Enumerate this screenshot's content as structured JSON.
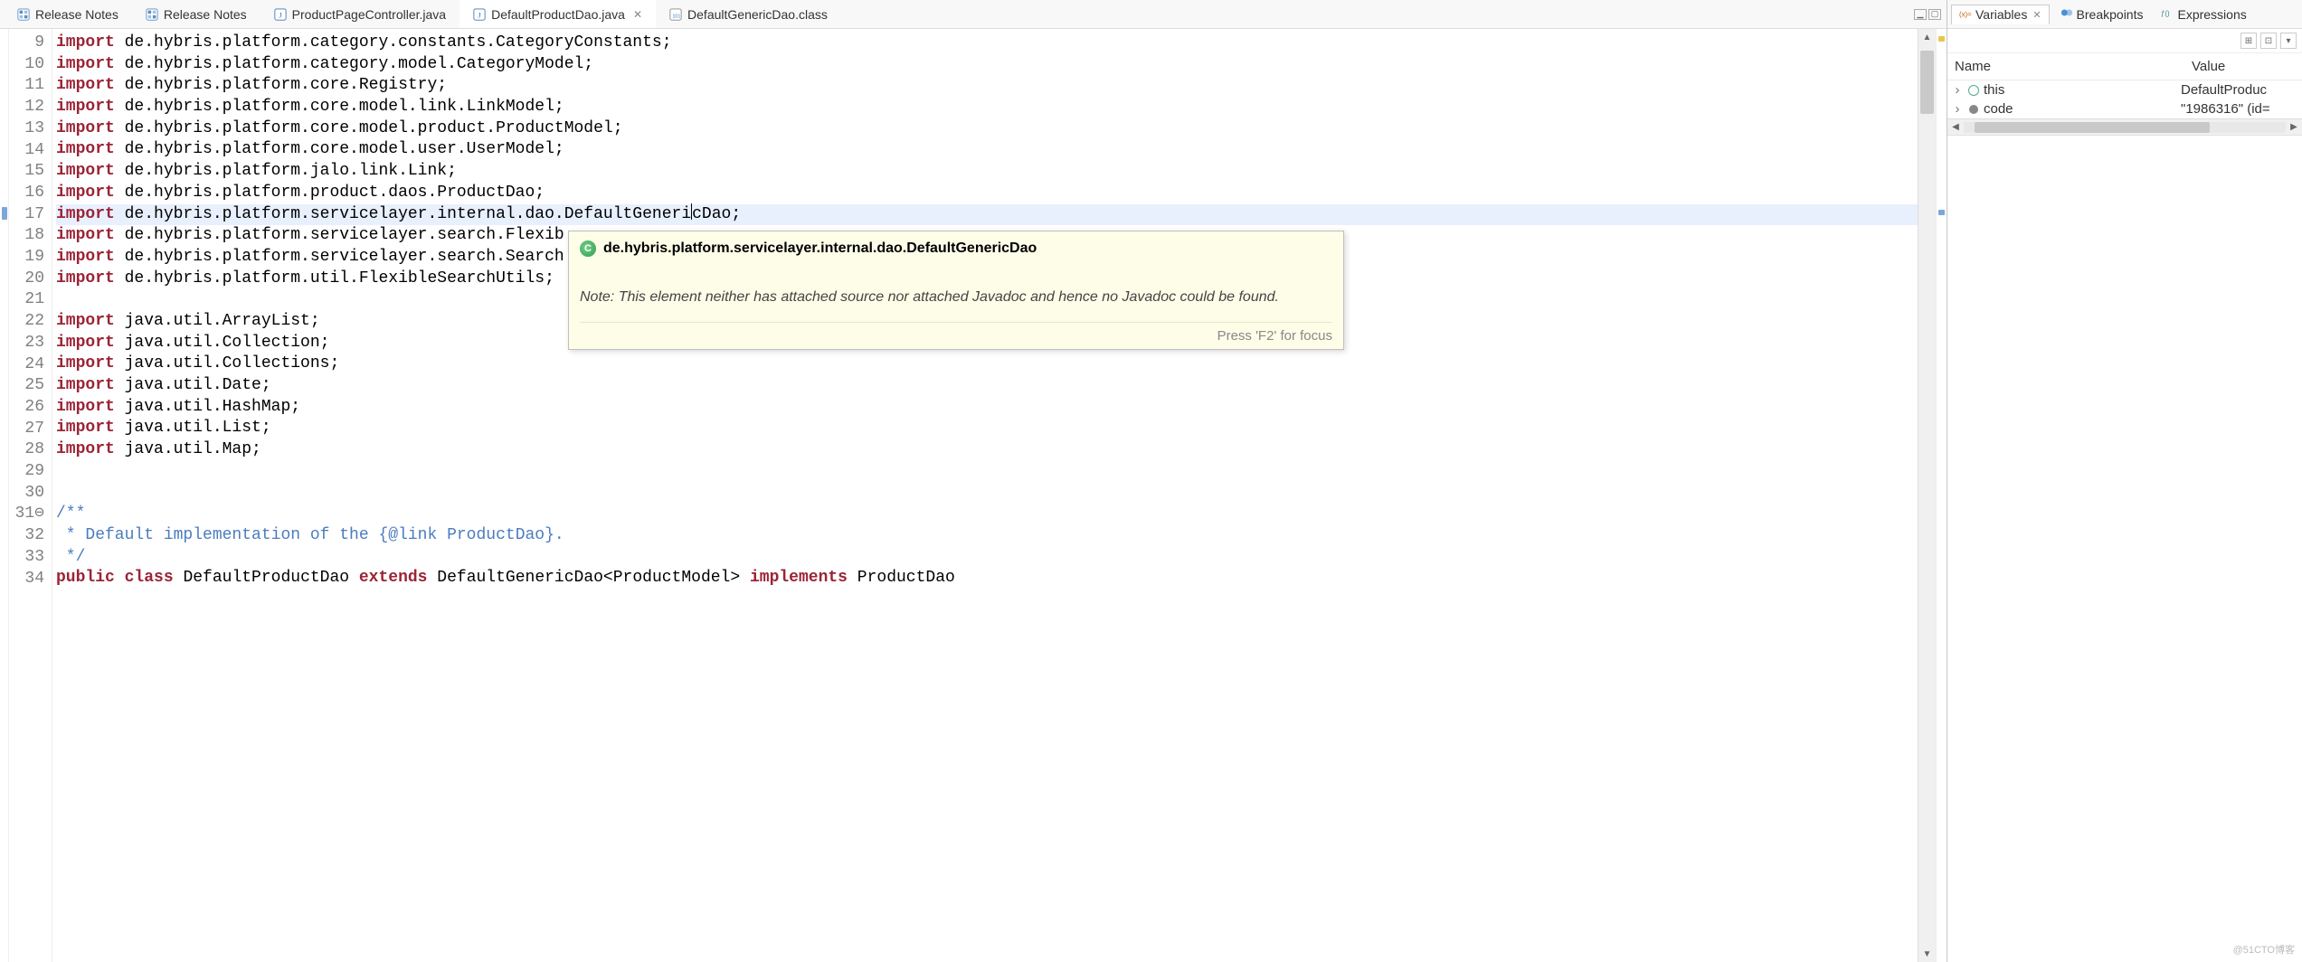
{
  "editor_tabs": [
    {
      "id": "release-notes-1",
      "label": "Release Notes",
      "icon": "feature",
      "active": false,
      "closable": false
    },
    {
      "id": "release-notes-2",
      "label": "Release Notes",
      "icon": "feature",
      "active": false,
      "closable": false
    },
    {
      "id": "product-page-controller",
      "label": "ProductPageController.java",
      "icon": "java",
      "active": false,
      "closable": false
    },
    {
      "id": "default-product-dao",
      "label": "DefaultProductDao.java",
      "icon": "java",
      "active": true,
      "closable": true
    },
    {
      "id": "default-generic-dao",
      "label": "DefaultGenericDao.class",
      "icon": "class",
      "active": false,
      "closable": false
    }
  ],
  "right_tabs": [
    {
      "id": "variables",
      "label": "Variables",
      "active": true,
      "closable": true
    },
    {
      "id": "breakpoints",
      "label": "Breakpoints",
      "active": false,
      "closable": false
    },
    {
      "id": "expressions",
      "label": "Expressions",
      "active": false,
      "closable": false
    }
  ],
  "variables_view": {
    "columns": {
      "name": "Name",
      "value": "Value"
    },
    "rows": [
      {
        "name": "this",
        "value": "DefaultProduc",
        "icon": "circle"
      },
      {
        "name": "code",
        "value": "\"1986316\" (id=",
        "icon": "dot"
      }
    ]
  },
  "line_start": 9,
  "highlighted_line": 17,
  "code_lines": [
    {
      "n": 9,
      "tokens": [
        [
          "import",
          "kw-import"
        ],
        [
          " de.hybris.platform.category.constants.CategoryConstants;",
          null
        ]
      ]
    },
    {
      "n": 10,
      "tokens": [
        [
          "import",
          "kw-import"
        ],
        [
          " de.hybris.platform.category.model.CategoryModel;",
          null
        ]
      ]
    },
    {
      "n": 11,
      "tokens": [
        [
          "import",
          "kw-import"
        ],
        [
          " de.hybris.platform.core.Registry;",
          null
        ]
      ]
    },
    {
      "n": 12,
      "tokens": [
        [
          "import",
          "kw-import"
        ],
        [
          " de.hybris.platform.core.model.link.LinkModel;",
          null
        ]
      ]
    },
    {
      "n": 13,
      "tokens": [
        [
          "import",
          "kw-import"
        ],
        [
          " de.hybris.platform.core.model.product.ProductModel;",
          null
        ]
      ]
    },
    {
      "n": 14,
      "tokens": [
        [
          "import",
          "kw-import"
        ],
        [
          " de.hybris.platform.core.model.user.UserModel;",
          null
        ]
      ]
    },
    {
      "n": 15,
      "tokens": [
        [
          "import",
          "kw-import"
        ],
        [
          " de.hybris.platform.jalo.link.Link;",
          null
        ]
      ]
    },
    {
      "n": 16,
      "tokens": [
        [
          "import",
          "kw-import"
        ],
        [
          " de.hybris.platform.product.daos.ProductDao;",
          null
        ]
      ]
    },
    {
      "n": 17,
      "highlight": true,
      "cursor_after": "DefaultGeneri",
      "tokens": [
        [
          "import",
          "kw-import"
        ],
        [
          " de.hybris.platform.servicelayer.internal.dao.DefaultGeneri",
          null
        ],
        [
          "|",
          "cursor"
        ],
        [
          "cDao;",
          null
        ]
      ]
    },
    {
      "n": 18,
      "tokens": [
        [
          "import",
          "kw-import"
        ],
        [
          " de.hybris.platform.servicelayer.search.Flexib",
          null
        ]
      ]
    },
    {
      "n": 19,
      "tokens": [
        [
          "import",
          "kw-import"
        ],
        [
          " de.hybris.platform.servicelayer.search.Search",
          null
        ]
      ]
    },
    {
      "n": 20,
      "tokens": [
        [
          "import",
          "kw-import"
        ],
        [
          " de.hybris.platform.util.FlexibleSearchUtils;",
          null
        ]
      ]
    },
    {
      "n": 21,
      "tokens": [
        [
          "",
          null
        ]
      ]
    },
    {
      "n": 22,
      "tokens": [
        [
          "import",
          "kw-import"
        ],
        [
          " java.util.ArrayList;",
          null
        ]
      ]
    },
    {
      "n": 23,
      "tokens": [
        [
          "import",
          "kw-import"
        ],
        [
          " java.util.Collection;",
          null
        ]
      ]
    },
    {
      "n": 24,
      "tokens": [
        [
          "import",
          "kw-import"
        ],
        [
          " java.util.Collections;",
          null
        ]
      ]
    },
    {
      "n": 25,
      "tokens": [
        [
          "import",
          "kw-import"
        ],
        [
          " java.util.Date;",
          null
        ]
      ]
    },
    {
      "n": 26,
      "tokens": [
        [
          "import",
          "kw-import"
        ],
        [
          " java.util.HashMap;",
          null
        ]
      ]
    },
    {
      "n": 27,
      "tokens": [
        [
          "import",
          "kw-import"
        ],
        [
          " java.util.List;",
          null
        ]
      ]
    },
    {
      "n": 28,
      "tokens": [
        [
          "import",
          "kw-import"
        ],
        [
          " java.util.Map;",
          null
        ]
      ]
    },
    {
      "n": 29,
      "tokens": [
        [
          "",
          null
        ]
      ]
    },
    {
      "n": 30,
      "tokens": [
        [
          "",
          null
        ]
      ]
    },
    {
      "n": 31,
      "fold": true,
      "tokens": [
        [
          "/**",
          "comment"
        ]
      ]
    },
    {
      "n": 32,
      "tokens": [
        [
          " * Default implementation of the {",
          "comment"
        ],
        [
          "@link",
          "comment"
        ],
        [
          " ProductDao}.",
          "comment"
        ]
      ]
    },
    {
      "n": 33,
      "tokens": [
        [
          " */",
          "comment"
        ]
      ]
    },
    {
      "n": 34,
      "tokens": [
        [
          "public",
          "kw-public"
        ],
        [
          " ",
          null
        ],
        [
          "class",
          "kw-class"
        ],
        [
          " DefaultProductDao ",
          null
        ],
        [
          "extends",
          "kw-extends"
        ],
        [
          " DefaultGenericDao<ProductModel> ",
          null
        ],
        [
          "implements",
          "kw-implements"
        ],
        [
          " ProductDao",
          null
        ]
      ]
    }
  ],
  "hover": {
    "title": "de.hybris.platform.servicelayer.internal.dao.DefaultGenericDao",
    "note": "Note: This element neither has attached source nor attached Javadoc and hence no Javadoc could be found.",
    "footer": "Press 'F2' for focus"
  },
  "watermark": "@51CTO博客"
}
